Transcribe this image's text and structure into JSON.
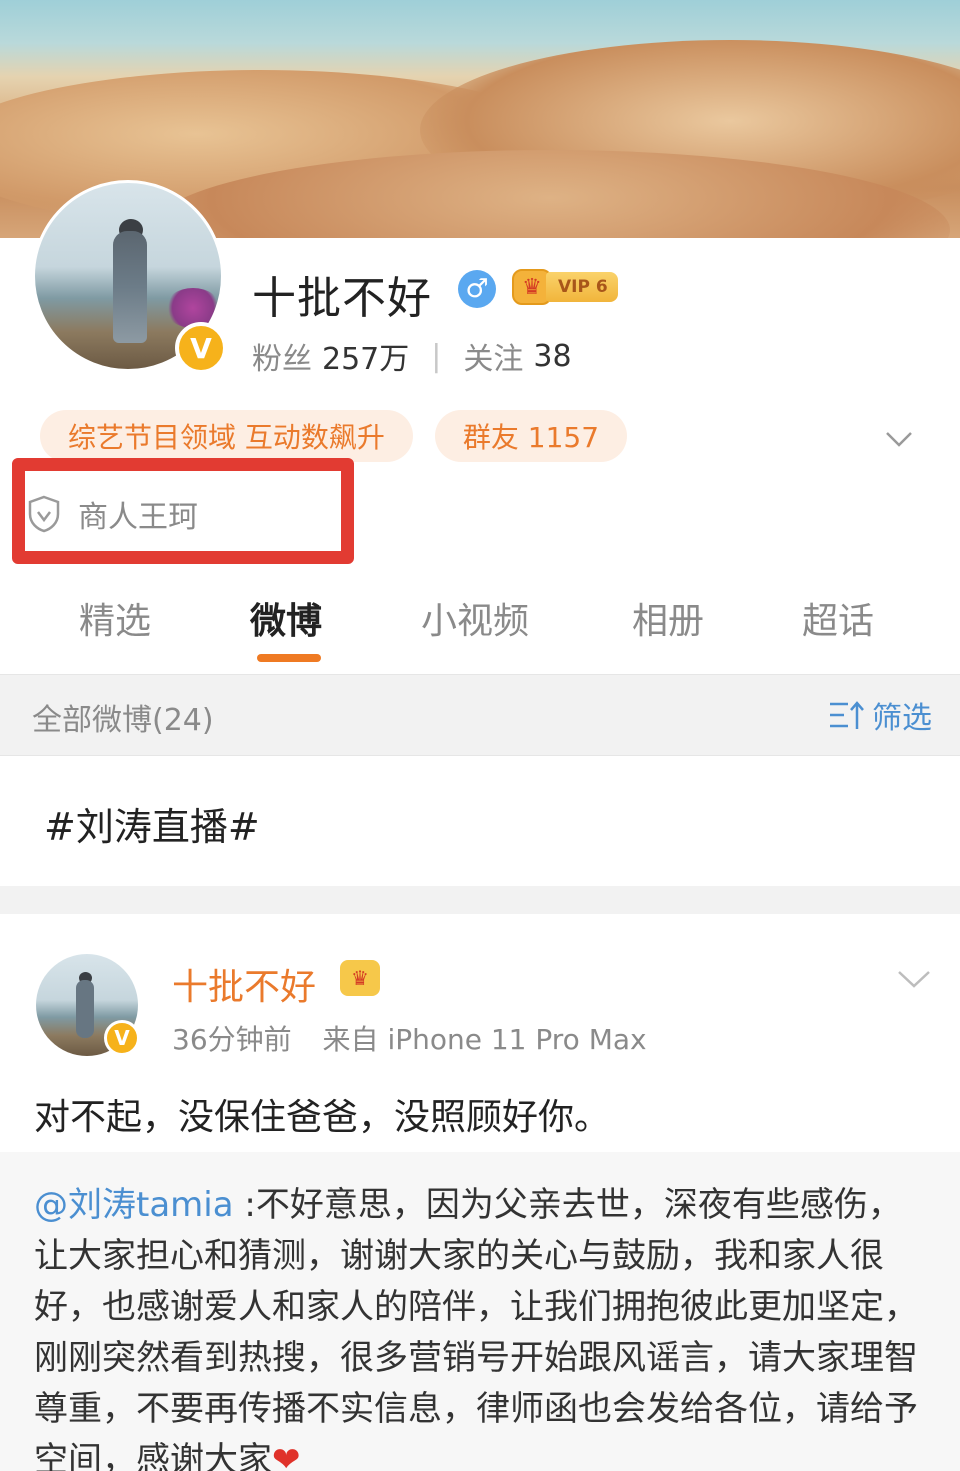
{
  "profile": {
    "name": "十批不好",
    "vip_level": "VIP 6",
    "verified_badge": "V",
    "fans_label": "粉丝",
    "fans_count": "257万",
    "following_label": "关注",
    "following_count": "38",
    "tags": [
      "综艺节目领域 互动数飙升",
      "群友 1157"
    ],
    "certification": "商人王珂"
  },
  "tabs": [
    {
      "label": "精选",
      "active": false
    },
    {
      "label": "微博",
      "active": true
    },
    {
      "label": "小视频",
      "active": false
    },
    {
      "label": "相册",
      "active": false
    },
    {
      "label": "超话",
      "active": false
    }
  ],
  "filter": {
    "label": "全部微博(24)",
    "button": "筛选"
  },
  "topic": "#刘涛直播#",
  "post": {
    "author": "十批不好",
    "time": "36分钟前",
    "source": "来自 iPhone 11 Pro Max",
    "text": "对不起，没保住爸爸，没照顾好你。",
    "repost_mention": "@刘涛tamia",
    "repost_text": " :不好意思，因为父亲去世，深夜有些感伤，让大家担心和猜测，谢谢大家的关心与鼓励，我和家人很好，也感谢爱人和家人的陪伴，让我们拥抱彼此更加坚定，刚刚突然看到热搜，很多营销号开始跟风谣言，请大家理智尊重，不要再传播不实信息，律师函也会发给各位，请给予空间，感谢大家",
    "repost_emoji": "❤"
  },
  "icons": {
    "gender": "male-icon",
    "crown": "vip-crown-icon",
    "shield": "shield-check-icon",
    "chevron": "chevron-down-icon",
    "filter": "filter-sort-icon"
  },
  "colors": {
    "accent_orange": "#ea7a2c",
    "link_blue": "#4b8fd1",
    "highlight_red": "#e23b32",
    "verified_gold": "#f6b21b"
  }
}
